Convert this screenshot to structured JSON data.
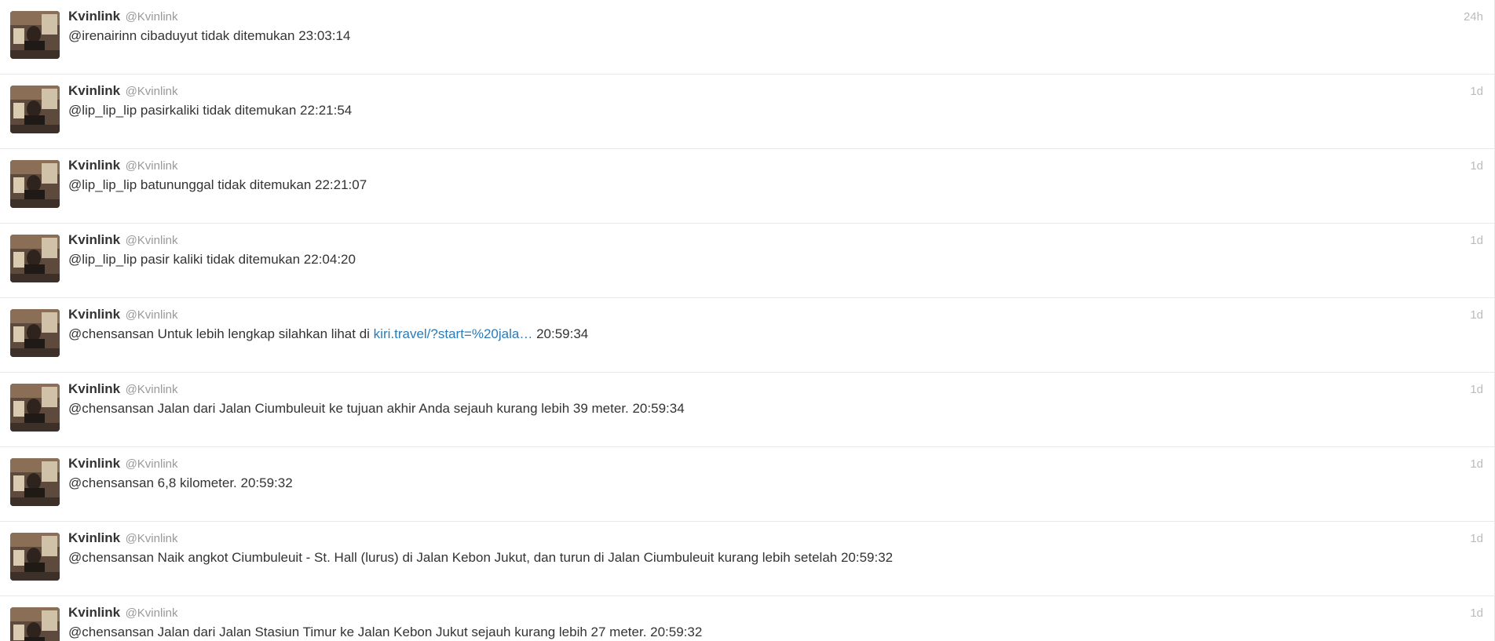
{
  "colors": {
    "name": "#333333",
    "handle": "#999999",
    "timestamp": "#bbbbbb",
    "link": "#2b7bb9",
    "divider": "#e8e8e8"
  },
  "tweets": [
    {
      "name": "Kvinlink",
      "handle": "@Kvinlink",
      "time": "24h",
      "avatar_icon": "profile-photo",
      "text": "@irenairinn cibaduyut tidak ditemukan 23:03:14"
    },
    {
      "name": "Kvinlink",
      "handle": "@Kvinlink",
      "time": "1d",
      "avatar_icon": "profile-photo",
      "text": "@lip_lip_lip pasirkaliki tidak ditemukan 22:21:54"
    },
    {
      "name": "Kvinlink",
      "handle": "@Kvinlink",
      "time": "1d",
      "avatar_icon": "profile-photo",
      "text": "@lip_lip_lip batununggal tidak ditemukan 22:21:07"
    },
    {
      "name": "Kvinlink",
      "handle": "@Kvinlink",
      "time": "1d",
      "avatar_icon": "profile-photo",
      "text": "@lip_lip_lip pasir kaliki tidak ditemukan 22:04:20"
    },
    {
      "name": "Kvinlink",
      "handle": "@Kvinlink",
      "time": "1d",
      "avatar_icon": "profile-photo",
      "text_before": "@chensansan Untuk lebih lengkap silahkan lihat di ",
      "link": "kiri.travel/?start=%20jala…",
      "text_after": " 20:59:34"
    },
    {
      "name": "Kvinlink",
      "handle": "@Kvinlink",
      "time": "1d",
      "avatar_icon": "profile-photo",
      "text": "@chensansan Jalan dari Jalan Ciumbuleuit ke tujuan akhir Anda sejauh kurang lebih 39 meter. 20:59:34"
    },
    {
      "name": "Kvinlink",
      "handle": "@Kvinlink",
      "time": "1d",
      "avatar_icon": "profile-photo",
      "text": "@chensansan 6,8 kilometer. 20:59:32"
    },
    {
      "name": "Kvinlink",
      "handle": "@Kvinlink",
      "time": "1d",
      "avatar_icon": "profile-photo",
      "text": "@chensansan Naik angkot Ciumbuleuit - St. Hall (lurus) di Jalan Kebon Jukut, dan turun di Jalan Ciumbuleuit kurang lebih setelah 20:59:32"
    },
    {
      "name": "Kvinlink",
      "handle": "@Kvinlink",
      "time": "1d",
      "avatar_icon": "profile-photo",
      "text": "@chensansan Jalan dari Jalan Stasiun Timur ke Jalan Kebon Jukut sejauh kurang lebih 27 meter. 20:59:32"
    }
  ]
}
